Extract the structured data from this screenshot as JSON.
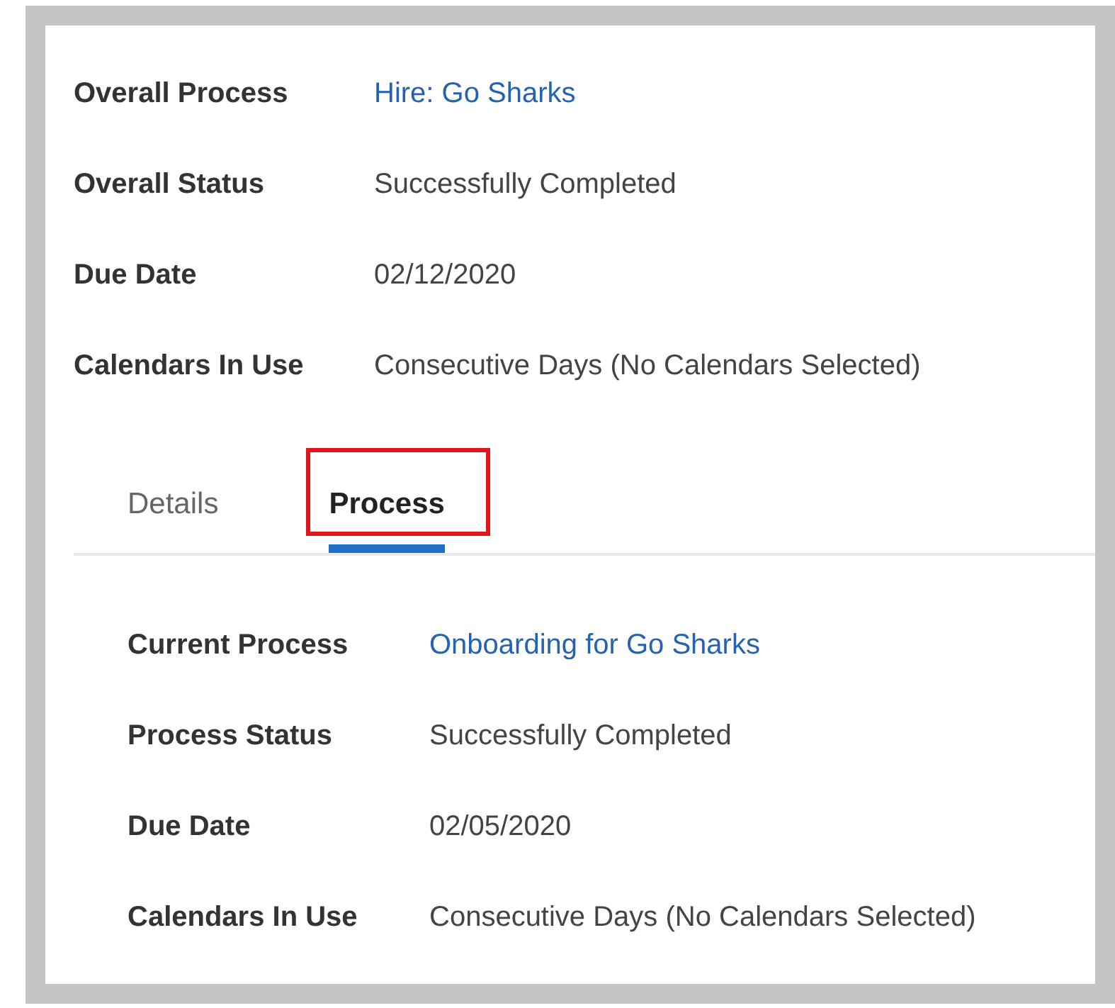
{
  "summary": [
    {
      "label": "Overall Process",
      "value": "Hire: Go Sharks",
      "kind": "link"
    },
    {
      "label": "Overall Status",
      "value": "Successfully Completed",
      "kind": "text"
    },
    {
      "label": "Due Date",
      "value": "02/12/2020",
      "kind": "text"
    },
    {
      "label": "Calendars In Use",
      "value": "Consecutive Days (No Calendars Selected)",
      "kind": "text"
    }
  ],
  "tabs": [
    {
      "label": "Details",
      "selected": false,
      "highlighted": false
    },
    {
      "label": "Process",
      "selected": true,
      "highlighted": true
    }
  ],
  "process": [
    {
      "label": "Current Process",
      "value": "Onboarding for Go Sharks",
      "kind": "link"
    },
    {
      "label": "Process Status",
      "value": "Successfully Completed",
      "kind": "text"
    },
    {
      "label": "Due Date",
      "value": "02/05/2020",
      "kind": "text"
    },
    {
      "label": "Calendars In Use",
      "value": "Consecutive Days (No Calendars Selected)",
      "kind": "text"
    }
  ]
}
